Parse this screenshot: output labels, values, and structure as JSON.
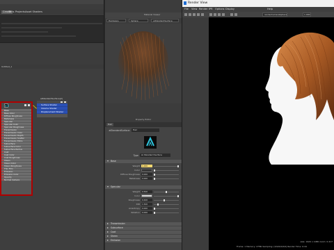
{
  "hypershade": {
    "tabs": [
      "Create",
      "Bins",
      "Projects",
      "Asset Shaders"
    ],
    "graph_header": "Untitled_1",
    "node_aistandard": {
      "title": "aiStandardSurface",
      "attributes": [
        "Base",
        "Base Color",
        "Diffuse Roughness",
        "Metalness",
        "Specular",
        "Specular Color",
        "Specular Roughness",
        "Transmission",
        "Transmission Color",
        "Transmission Depth",
        "Transmission Scatter",
        "Transmission Extra Roughness",
        "Subsurface",
        "Subsurface Color",
        "Subsurface Radius",
        "Coat",
        "Coat Color",
        "Coat Roughness",
        "Sheen",
        "Sheen Color",
        "Sheen Roughness",
        "Thin Film",
        "Emission",
        "Emission Color",
        "Opacity",
        "Normal Camera"
      ]
    },
    "node_hair": {
      "title": "aiStandardSurface(2)",
      "attributes": [
        "Surface Shader",
        "Volume Shader",
        "Displacement Shader"
      ]
    }
  },
  "middle": {
    "header_label": "Material Viewer",
    "toolbar": [
      "Hardware",
      "Sphere",
      "aiStandardSurface"
    ],
    "ae_title": "Property Editor",
    "ae_tab": "Hair",
    "shader_label": "aiStandardSurface:",
    "shader_value": "Hair",
    "type_label": "Type",
    "type_value": "Ai Standard Surface",
    "sections": {
      "base": "Base",
      "specular": "Specular",
      "closed": [
        "Transmission",
        "Subsurface",
        "Coat",
        "Sheen",
        "Emission"
      ]
    },
    "base_rows": [
      {
        "label": "Weight",
        "value": "1.000",
        "highlight": true
      },
      {
        "label": "Color",
        "value": ""
      },
      {
        "label": "Diffuse Roughness",
        "value": "0.000"
      },
      {
        "label": "Metalness",
        "value": "0.000"
      }
    ],
    "specular_rows": [
      {
        "label": "Weight",
        "value": "0.500"
      },
      {
        "label": "Color",
        "value": ""
      },
      {
        "label": "Roughness",
        "value": "0.400"
      },
      {
        "label": "IOR",
        "value": "1.500"
      },
      {
        "label": "Anisotropy",
        "value": "0.000"
      },
      {
        "label": "Rotation",
        "value": "0.000"
      }
    ]
  },
  "render_view": {
    "title": "Render View",
    "menus": [
      "File",
      "View",
      "Render",
      "IPR",
      "Options",
      "Display",
      "Help"
    ],
    "camera": "renderCameraSphere",
    "zoom": "1.000",
    "status_top": "size: 1920 x 1080  zoom: 0.417",
    "status_bottom": "Frame: 1   Memory: 27Mb   Sampling: [3/0/0/0/0/0]   Render Time: 0:16"
  }
}
